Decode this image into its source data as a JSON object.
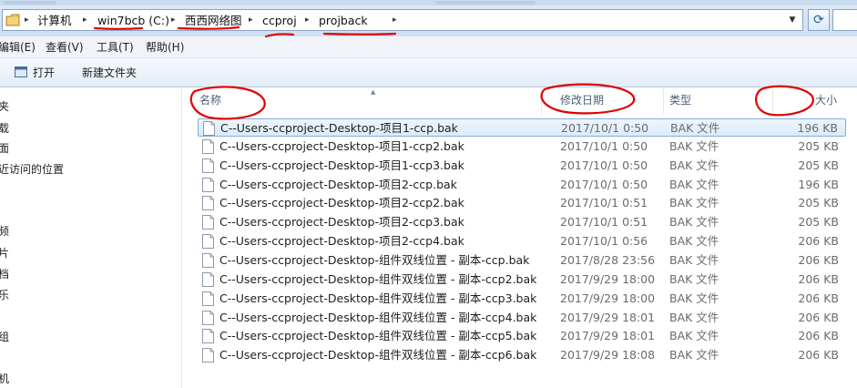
{
  "address_bar": {
    "crumbs": [
      "计算机",
      "win7bcb (C:)",
      "西西网络图",
      "ccproj",
      "projback"
    ]
  },
  "menu": [
    "编辑(E)",
    "查看(V)",
    "工具(T)",
    "帮助(H)"
  ],
  "toolbar": {
    "open_label": "打开",
    "new_folder_label": "新建文件夹"
  },
  "nav_pane": {
    "items": [
      "夹",
      "载",
      "面",
      "近访问的位置",
      "频",
      "片",
      "档",
      "乐",
      "组",
      "机"
    ]
  },
  "columns": {
    "name": "名称",
    "date": "修改日期",
    "type": "类型",
    "size": "大小"
  },
  "files": [
    {
      "name": "C--Users-ccproject-Desktop-项目1-ccp.bak",
      "date": "2017/10/1 0:50",
      "type": "BAK 文件",
      "size": "196 KB",
      "selected": true
    },
    {
      "name": "C--Users-ccproject-Desktop-项目1-ccp2.bak",
      "date": "2017/10/1 0:50",
      "type": "BAK 文件",
      "size": "205 KB"
    },
    {
      "name": "C--Users-ccproject-Desktop-项目1-ccp3.bak",
      "date": "2017/10/1 0:50",
      "type": "BAK 文件",
      "size": "205 KB"
    },
    {
      "name": "C--Users-ccproject-Desktop-项目2-ccp.bak",
      "date": "2017/10/1 0:50",
      "type": "BAK 文件",
      "size": "196 KB"
    },
    {
      "name": "C--Users-ccproject-Desktop-项目2-ccp2.bak",
      "date": "2017/10/1 0:51",
      "type": "BAK 文件",
      "size": "205 KB"
    },
    {
      "name": "C--Users-ccproject-Desktop-项目2-ccp3.bak",
      "date": "2017/10/1 0:51",
      "type": "BAK 文件",
      "size": "205 KB"
    },
    {
      "name": "C--Users-ccproject-Desktop-项目2-ccp4.bak",
      "date": "2017/10/1 0:56",
      "type": "BAK 文件",
      "size": "206 KB"
    },
    {
      "name": "C--Users-ccproject-Desktop-组件双线位置 - 副本-ccp.bak",
      "date": "2017/8/28 23:56",
      "type": "BAK 文件",
      "size": "206 KB"
    },
    {
      "name": "C--Users-ccproject-Desktop-组件双线位置 - 副本-ccp2.bak",
      "date": "2017/9/29 18:00",
      "type": "BAK 文件",
      "size": "206 KB"
    },
    {
      "name": "C--Users-ccproject-Desktop-组件双线位置 - 副本-ccp3.bak",
      "date": "2017/9/29 18:00",
      "type": "BAK 文件",
      "size": "206 KB"
    },
    {
      "name": "C--Users-ccproject-Desktop-组件双线位置 - 副本-ccp4.bak",
      "date": "2017/9/29 18:01",
      "type": "BAK 文件",
      "size": "206 KB"
    },
    {
      "name": "C--Users-ccproject-Desktop-组件双线位置 - 副本-ccp5.bak",
      "date": "2017/9/29 18:01",
      "type": "BAK 文件",
      "size": "206 KB"
    },
    {
      "name": "C--Users-ccproject-Desktop-组件双线位置 - 副本-ccp6.bak",
      "date": "2017/9/29 18:08",
      "type": "BAK 文件",
      "size": "206 KB"
    }
  ],
  "colors": {
    "annotation": "#e00000",
    "selection_border": "#84acdd",
    "header_text": "#4c607a"
  }
}
